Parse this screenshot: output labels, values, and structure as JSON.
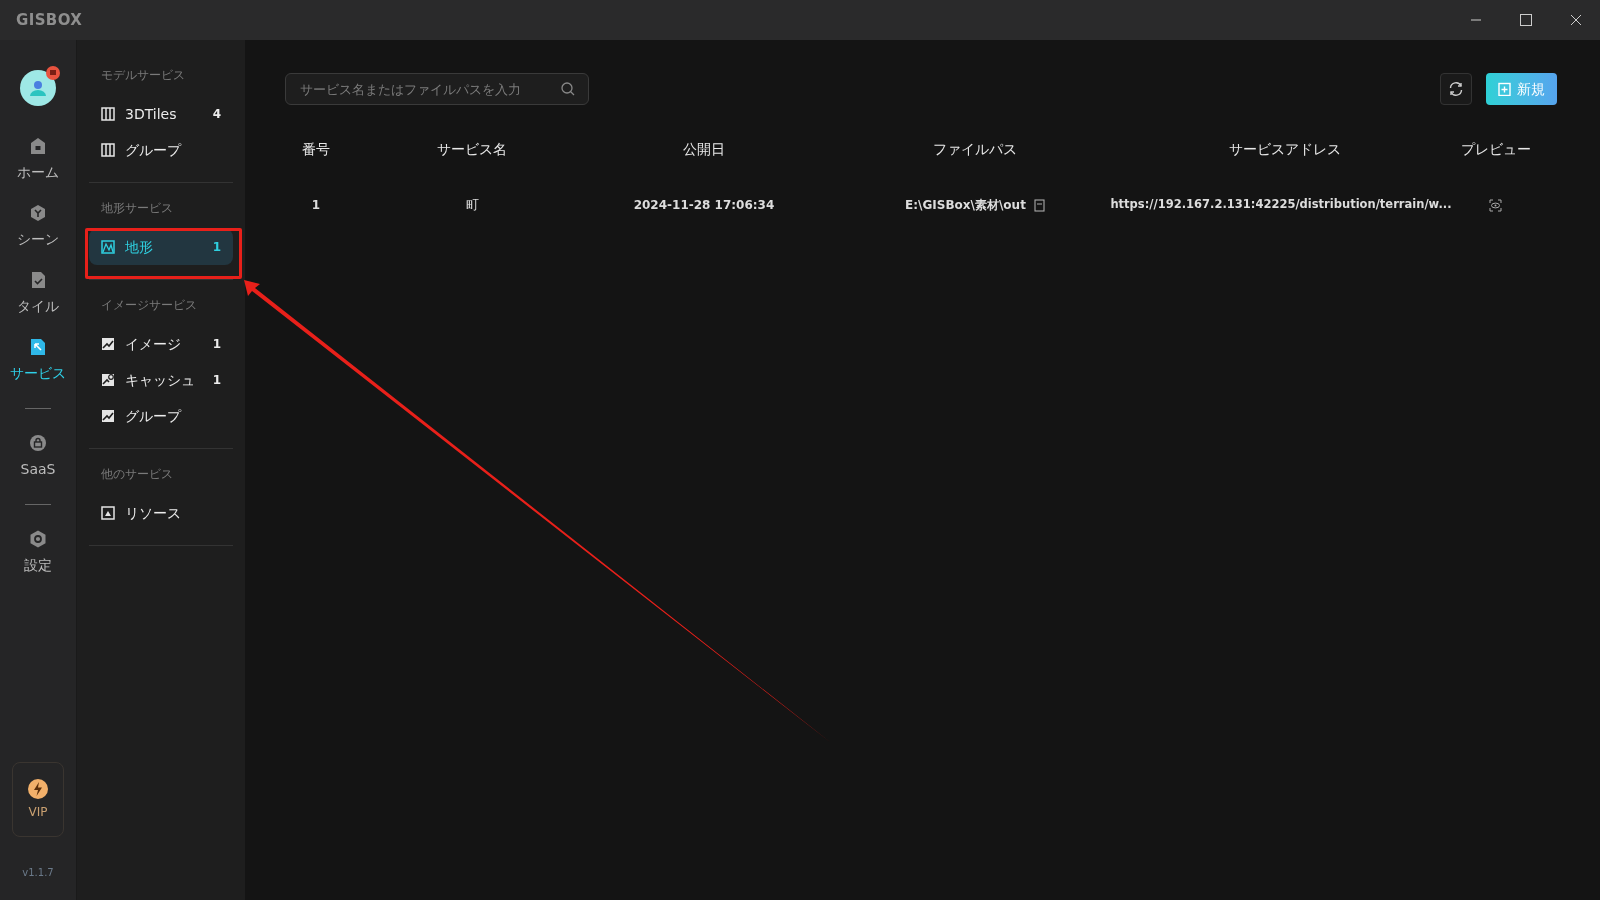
{
  "app": {
    "logo": "GISBOX"
  },
  "nav_groups": [
    [
      {
        "kind": "home",
        "label": "ホーム",
        "selected": false
      },
      {
        "kind": "scene",
        "label": "シーン",
        "selected": false
      },
      {
        "kind": "tile",
        "label": "タイル",
        "selected": false
      },
      {
        "kind": "service",
        "label": "サービス",
        "selected": true
      }
    ],
    [
      {
        "kind": "saas",
        "label": "SaaS",
        "selected": false
      }
    ],
    [
      {
        "kind": "settings",
        "label": "設定",
        "selected": false
      }
    ]
  ],
  "vip": {
    "label": "VIP"
  },
  "version": "v1.1.7",
  "sidebar": [
    {
      "title": "モデルサービス",
      "items": [
        {
          "kind": "model",
          "label": "3DTiles",
          "count": "4",
          "selected": false
        },
        {
          "kind": "model",
          "label": "グループ",
          "selected": false
        }
      ]
    },
    {
      "title": "地形サービス",
      "items": [
        {
          "kind": "terrain",
          "label": "地形",
          "count": "1",
          "selected": true
        }
      ]
    },
    {
      "title": "イメージサービス",
      "items": [
        {
          "kind": "image",
          "label": "イメージ",
          "count": "1",
          "selected": false
        },
        {
          "kind": "cache",
          "label": "キャッシュ",
          "count": "1",
          "selected": false
        },
        {
          "kind": "image",
          "label": "グループ",
          "selected": false
        }
      ]
    },
    {
      "title": "他のサービス",
      "items": [
        {
          "kind": "resource",
          "label": "リソース",
          "selected": false
        }
      ]
    }
  ],
  "search": {
    "placeholder": "サービス名またはファイルパスを入力"
  },
  "new_button": {
    "label": "新規"
  },
  "table": {
    "columns": [
      "番号",
      "サービス名",
      "公開日",
      "ファイルパス",
      "サービスアドレス",
      "プレビュー"
    ],
    "rows": [
      {
        "number": "1",
        "name": "町",
        "date": "2024-11-28 17:06:34",
        "path": "E:\\GISBox\\素材\\out",
        "address": "https://192.167.2.131:42225/distribution/terrain/w..."
      }
    ]
  }
}
